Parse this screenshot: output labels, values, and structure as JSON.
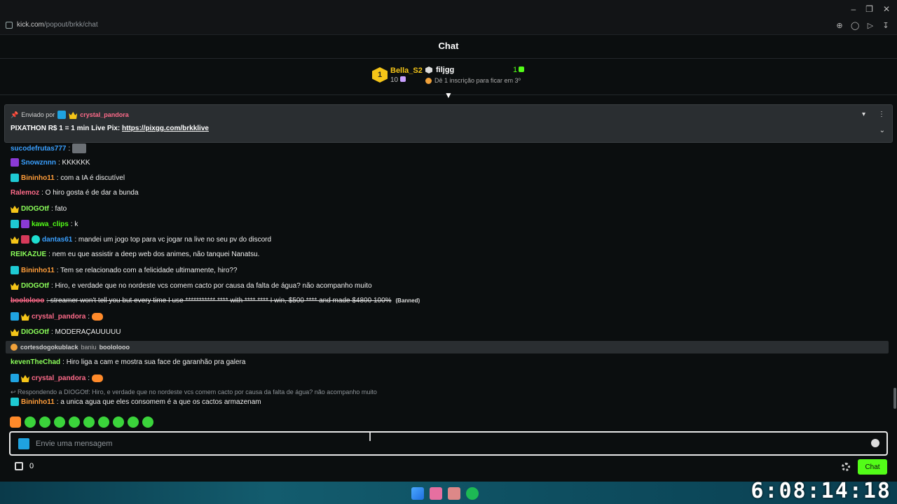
{
  "browser": {
    "url_host": "kick.com",
    "url_path": "/popout/brkk/chat"
  },
  "header": {
    "title": "Chat"
  },
  "leaderboard": {
    "first": {
      "rank": "1",
      "name": "Bella_S2",
      "count": "10"
    },
    "second": {
      "name": "filjgg",
      "note": "Dê 1 inscrição para ficar em 3º",
      "count": "1"
    }
  },
  "pinned": {
    "sent_by": "Enviado por",
    "user": "crystal_pandora",
    "text": "PIXATHON R$ 1 = 1 min Live Pix: ",
    "link": "https://pixgg.com/brkklive"
  },
  "messages": [
    {
      "user": "sucodefrutas777",
      "text": ":"
    },
    {
      "user": "Snowznnn",
      "text": ": KKKKKK"
    },
    {
      "user": "Bininho11",
      "text": ": com a IA é discutível"
    },
    {
      "user": "Ralemoz",
      "text": ": O hiro gosta é de dar a bunda"
    },
    {
      "user": "DIOGOtf",
      "text": ": fato"
    },
    {
      "user": "kawa_clips",
      "text": ": k"
    },
    {
      "user": "dantas61",
      "text": ": mandei um jogo top para vc jogar na live no seu pv do discord"
    },
    {
      "user": "REIKAZUE",
      "text": ": nem eu que assistir a deep web dos animes, não tanquei Nanatsu."
    },
    {
      "user": "Bininho11",
      "text": ": Tem se relacionado com a felicidade ultimamente, hiro??"
    },
    {
      "user": "DIOGOtf",
      "text": ": Hiro, e verdade que no nordeste vcs comem cacto por causa da falta de água? não acompanho muito"
    },
    {
      "user": "boolo​looo",
      "text": ": streamer won't tell you but every time I use *********** **** with **** **** I win, $500 **** and made $4800 100% ",
      "banned": "(Banned)"
    },
    {
      "user": "crystal_pandora",
      "text": ":"
    },
    {
      "user": "DIOGOtf",
      "text": ": MODERAÇAUUUUU"
    },
    {
      "user": "kevenTheChad",
      "text": ": Hiro liga a cam e mostra sua face de garanhão pra galera"
    },
    {
      "user": "crystal_pandora",
      "text": ":"
    },
    {
      "user": "Bininho11",
      "text": ": a unica agua que eles consomem é a que os cactos armazenam"
    }
  ],
  "ban_notice": {
    "mod": "cortesdogokublack",
    "action": "baniu",
    "target": "boolo​looo"
  },
  "reply_context": "Respondendo a DIOGOtf: Hiro, e verdade que no nordeste vcs comem cacto por causa da falta de água? não acompanho muito",
  "input": {
    "placeholder": "Envie uma mensagem"
  },
  "footer": {
    "points": "0",
    "chat_button": "Chat"
  },
  "taskbar": {
    "clock": "6:08:14:18"
  },
  "colors": {
    "accent": "#53fc18",
    "background": "#0b0e0f",
    "pinned_bg": "#2a2e31"
  }
}
